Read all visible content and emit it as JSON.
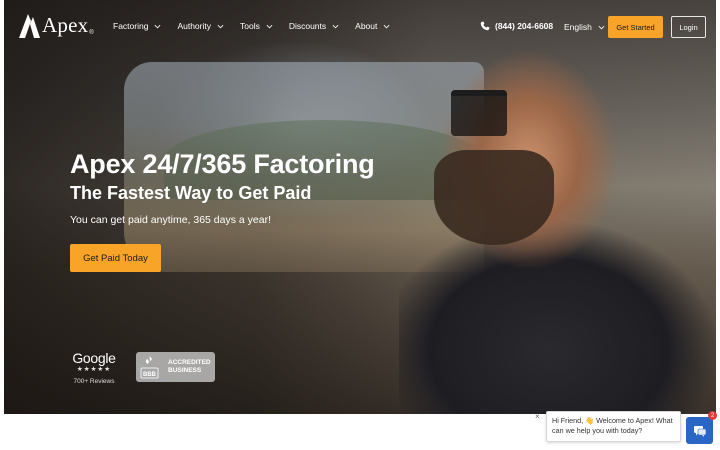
{
  "brand": {
    "name": "Apex",
    "registered": "®",
    "accent": "#f7a428"
  },
  "nav": {
    "menu": [
      {
        "label": "Factoring",
        "icon": "chevron-down-icon"
      },
      {
        "label": "Authority",
        "icon": "chevron-down-icon"
      },
      {
        "label": "Tools",
        "icon": "chevron-down-icon"
      },
      {
        "label": "Discounts",
        "icon": "chevron-down-icon"
      },
      {
        "label": "About",
        "icon": "chevron-down-icon"
      }
    ],
    "phone": "(844) 204-6608",
    "phone_icon": "phone-icon",
    "language": "English",
    "get_started": "Get Started",
    "login": "Login"
  },
  "hero": {
    "title": "Apex 24/7/365 Factoring",
    "subtitle": "The Fastest Way to Get Paid",
    "description": "You can get paid anytime, 365 days a year!",
    "cta": "Get Paid Today"
  },
  "badges": {
    "google": {
      "word": "Google",
      "stars": "★★★★★",
      "reviews": "700+ Reviews"
    },
    "bbb": {
      "seal_text": "BBB",
      "line1": "ACCREDITED",
      "line2": "BUSINESS"
    }
  },
  "chat": {
    "message": "Hi Friend, 👋 Welcome to Apex! What can we help you with today?",
    "close": "×",
    "unread": "2",
    "launcher_color": "#2a67c4"
  }
}
